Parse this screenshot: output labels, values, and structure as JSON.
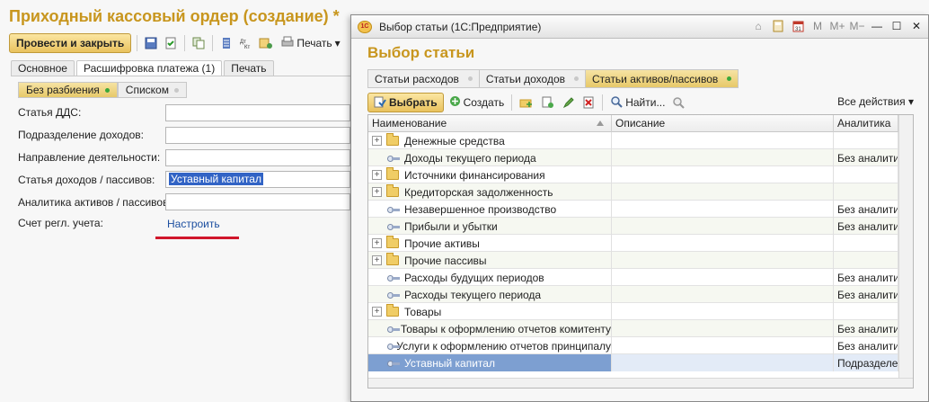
{
  "form": {
    "title": "Приходный кассовый ордер (создание) *",
    "toolbar": {
      "post_close": "Провести и закрыть",
      "print": "Печать"
    },
    "tabs": [
      "Основное",
      "Расшифровка платежа (1)",
      "Печать"
    ],
    "split_modes": [
      "Без разбиения",
      "Списком"
    ],
    "fields": {
      "dds_label": "Статья ДДС:",
      "income_div_label": "Подразделение доходов:",
      "activity_label": "Направление деятельности:",
      "income_article_label": "Статья доходов / пассивов:",
      "income_article_value": "Уставный капитал",
      "analytics_label": "Аналитика активов / пассивов:",
      "account_label": "Счет регл. учета:",
      "account_link": "Настроить"
    }
  },
  "dialog": {
    "window_title": "Выбор статьи  (1С:Предприятие)",
    "heading": "Выбор статьи",
    "tabs": [
      "Статьи расходов",
      "Статьи доходов",
      "Статьи активов/пассивов"
    ],
    "toolbar": {
      "choose": "Выбрать",
      "create": "Создать",
      "find": "Найти...",
      "all_actions": "Все действия"
    },
    "columns": [
      "Наименование",
      "Описание",
      "Аналитика"
    ],
    "rows": [
      {
        "name": "Денежные средства",
        "type": "group",
        "analytics": ""
      },
      {
        "name": "Доходы текущего периода",
        "type": "item",
        "analytics": "Без аналитики"
      },
      {
        "name": "Источники финансирования",
        "type": "group",
        "analytics": ""
      },
      {
        "name": "Кредиторская задолженность",
        "type": "group",
        "analytics": ""
      },
      {
        "name": "Незавершенное производство",
        "type": "item",
        "analytics": "Без аналитики"
      },
      {
        "name": "Прибыли и убытки",
        "type": "item",
        "analytics": "Без аналитики"
      },
      {
        "name": "Прочие активы",
        "type": "group",
        "analytics": ""
      },
      {
        "name": "Прочие пассивы",
        "type": "group",
        "analytics": ""
      },
      {
        "name": "Расходы будущих периодов",
        "type": "item",
        "analytics": "Без аналитики"
      },
      {
        "name": "Расходы текущего периода",
        "type": "item",
        "analytics": "Без аналитики"
      },
      {
        "name": "Товары",
        "type": "group",
        "analytics": ""
      },
      {
        "name": "Товары к оформлению отчетов комитенту",
        "type": "item",
        "analytics": "Без аналитики"
      },
      {
        "name": "Услуги к оформлению отчетов принципалу",
        "type": "item",
        "analytics": "Без аналитики"
      },
      {
        "name": "Уставный капитал",
        "type": "item",
        "analytics": "Подразделение"
      }
    ]
  }
}
